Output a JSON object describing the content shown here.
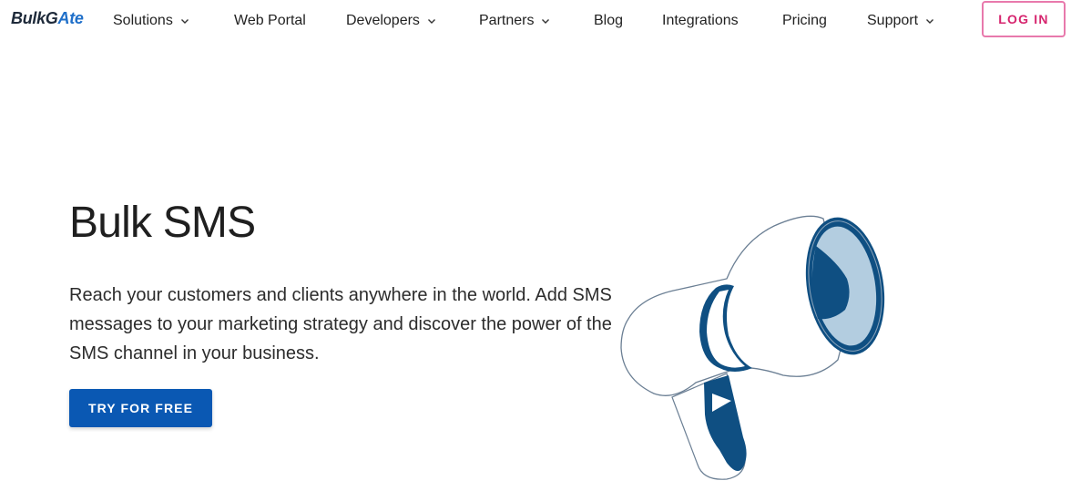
{
  "brand": {
    "logo_text_start": "BulkG",
    "logo_text_accent": "A",
    "logo_text_end": "te"
  },
  "nav": {
    "items": [
      {
        "label": "Solutions",
        "dropdown": true
      },
      {
        "label": "Web Portal",
        "dropdown": false
      },
      {
        "label": "Developers",
        "dropdown": true
      },
      {
        "label": "Partners",
        "dropdown": true
      },
      {
        "label": "Blog",
        "dropdown": false
      },
      {
        "label": "Integrations",
        "dropdown": false
      },
      {
        "label": "Pricing",
        "dropdown": false
      },
      {
        "label": "Support",
        "dropdown": true
      }
    ],
    "login_label": "LOG IN"
  },
  "hero": {
    "title": "Bulk SMS",
    "description": "Reach your customers and clients anywhere in the world. Add SMS messages to your marketing strategy and discover the power of the SMS channel in your business.",
    "cta_label": "TRY FOR FREE",
    "illustration": "megaphone-icon"
  },
  "colors": {
    "primary": "#0a58b3",
    "login_border": "#e879ac",
    "login_text": "#d6246e",
    "megaphone_dark": "#0f4f82",
    "megaphone_light": "#b3cde0"
  }
}
